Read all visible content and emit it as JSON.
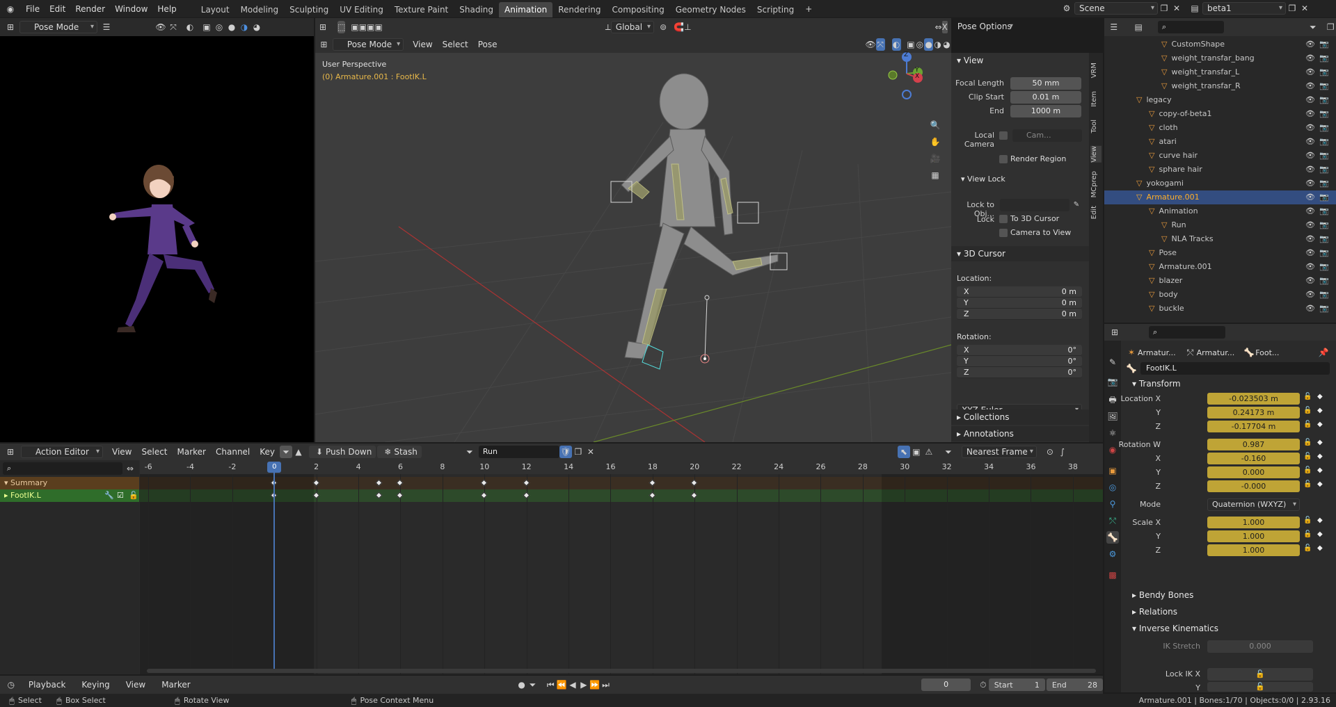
{
  "topbar": {
    "menus": [
      "File",
      "Edit",
      "Render",
      "Window",
      "Help"
    ],
    "workspaces": [
      "Layout",
      "Modeling",
      "Sculpting",
      "UV Editing",
      "Texture Paint",
      "Shading",
      "Animation",
      "Rendering",
      "Compositing",
      "Geometry Nodes",
      "Scripting"
    ],
    "active_workspace": "Animation",
    "scene": "Scene",
    "view_layer": "beta1"
  },
  "left_viewport": {
    "mode": "Pose Mode",
    "orientation": "Global"
  },
  "main_viewport": {
    "mode": "Pose Mode",
    "orientation": "Global",
    "menus": [
      "View",
      "Select",
      "Pose"
    ],
    "pose_options": "Pose Options",
    "overlay_title": "User Perspective",
    "overlay_sub": "(0) Armature.001 : FootIK.L",
    "gizmo_x": "X",
    "gizmo_y": "Y",
    "gizmo_z": "Z"
  },
  "npanel": {
    "tabs": [
      "VRM",
      "Item",
      "Tool",
      "View",
      "MCprep",
      "Edit"
    ],
    "view_title": "View",
    "focal_label": "Focal Length",
    "focal": "50 mm",
    "clip_start_label": "Clip Start",
    "clip_start": "0.01 m",
    "end_label": "End",
    "end": "1000 m",
    "local_camera_label": "Local Camera",
    "local_camera_value": "Cam...",
    "render_region": "Render Region",
    "view_lock_title": "View Lock",
    "lock_to_obj_label": "Lock to Obj...",
    "lock_label": "Lock",
    "to_3d_cursor": "To 3D Cursor",
    "camera_to_view": "Camera to View",
    "cursor_title": "3D Cursor",
    "location_label": "Location:",
    "loc": [
      {
        "k": "X",
        "v": "0 m"
      },
      {
        "k": "Y",
        "v": "0 m"
      },
      {
        "k": "Z",
        "v": "0 m"
      }
    ],
    "rotation_label": "Rotation:",
    "rot": [
      {
        "k": "X",
        "v": "0°"
      },
      {
        "k": "Y",
        "v": "0°"
      },
      {
        "k": "Z",
        "v": "0°"
      }
    ],
    "euler": "XYZ Euler",
    "collections": "Collections",
    "annotations": "Annotations"
  },
  "outliner": {
    "rows": [
      {
        "name": "CustomShape",
        "indent": 3
      },
      {
        "name": "weight_transfar_bang",
        "indent": 3
      },
      {
        "name": "weight_transfar_L",
        "indent": 3
      },
      {
        "name": "weight_transfar_R",
        "indent": 3
      },
      {
        "name": "legacy",
        "indent": 1
      },
      {
        "name": "copy-of-beta1",
        "indent": 2
      },
      {
        "name": "cloth",
        "indent": 2
      },
      {
        "name": "atari",
        "indent": 2
      },
      {
        "name": "curve hair",
        "indent": 2
      },
      {
        "name": "sphare hair",
        "indent": 2
      },
      {
        "name": "yokogami",
        "indent": 1
      },
      {
        "name": "Armature.001",
        "indent": 1,
        "sel": true
      },
      {
        "name": "Animation",
        "indent": 2
      },
      {
        "name": "Run",
        "indent": 3
      },
      {
        "name": "NLA Tracks",
        "indent": 3
      },
      {
        "name": "Pose",
        "indent": 2
      },
      {
        "name": "Armature.001",
        "indent": 2
      },
      {
        "name": "blazer",
        "indent": 2
      },
      {
        "name": "body",
        "indent": 2
      },
      {
        "name": "buckle",
        "indent": 2
      }
    ]
  },
  "properties": {
    "crumbs": [
      "Armatur...",
      "Armatur...",
      "Foot..."
    ],
    "bone_name": "FootIK.L",
    "transform": "Transform",
    "loc_label": "Location X",
    "loc": [
      "-0.023503 m",
      "0.24173 m",
      "-0.17704 m"
    ],
    "rot_label": "Rotation W",
    "rot": [
      "0.987",
      "-0.160",
      "0.000",
      "-0.000"
    ],
    "mode_label": "Mode",
    "mode": "Quaternion (WXYZ)",
    "scale_label": "Scale X",
    "scale": [
      "1.000",
      "1.000",
      "1.000"
    ],
    "axis_y": "Y",
    "axis_z": "Z",
    "axis_x": "X",
    "bendy": "Bendy Bones",
    "relations": "Relations",
    "ik": "Inverse Kinematics",
    "ik_stretch_label": "IK Stretch",
    "ik_stretch": "0.000",
    "lock_ik_x": "Lock IK X",
    "lock_ik_y": "Y"
  },
  "action_editor": {
    "mode": "Action Editor",
    "menus": [
      "View",
      "Select",
      "Marker",
      "Channel",
      "Key"
    ],
    "push_down": "Push Down",
    "stash": "Stash",
    "action": "Run",
    "snap": "Nearest Frame",
    "channels": [
      "Summary",
      "FootIK.L"
    ],
    "current_frame_label": "0",
    "ticks": [
      -6,
      -4,
      -2,
      0,
      2,
      4,
      6,
      8,
      10,
      12,
      14,
      16,
      18,
      20,
      22,
      24,
      26,
      28,
      30,
      32,
      34,
      36,
      38
    ],
    "keyframes": [
      0,
      2,
      5,
      6,
      10,
      12,
      18,
      20
    ]
  },
  "timeline": {
    "menus": [
      "Playback",
      "Keying",
      "View",
      "Marker"
    ],
    "frame": "0",
    "start_label": "Start",
    "start": "1",
    "end_label": "End",
    "end": "28"
  },
  "statusbar": {
    "select": "Select",
    "box_select": "Box Select",
    "rotate_view": "Rotate View",
    "context_menu": "Pose Context Menu",
    "info": "Armature.001 | Bones:1/70 | Objects:0/0 | 2.93.16"
  }
}
